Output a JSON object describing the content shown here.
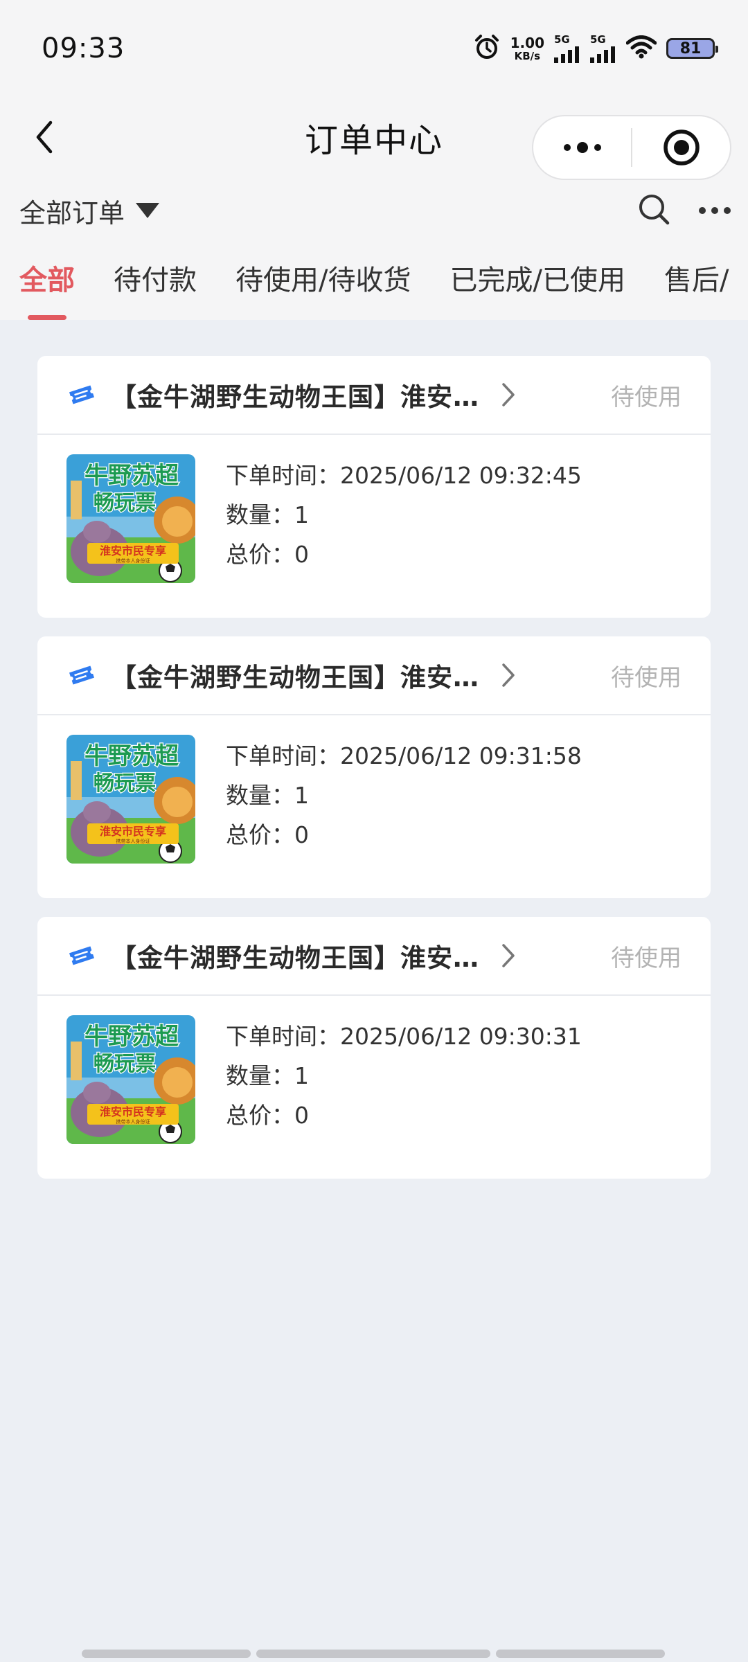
{
  "status_bar": {
    "time": "09:33",
    "net_speed_value": "1.00",
    "net_speed_unit": "KB/s",
    "sim1": "5G",
    "sim2": "5G",
    "battery": "81"
  },
  "nav": {
    "title": "订单中心",
    "back_icon": "chevron-left-icon",
    "more_icon": "more-dots-icon",
    "target_icon": "record-target-icon"
  },
  "filter": {
    "label": "全部订单",
    "dropdown_icon": "triangle-down-icon",
    "search_icon": "search-icon",
    "more_icon": "ellipsis-icon"
  },
  "tabs": [
    {
      "label": "全部",
      "active": true
    },
    {
      "label": "待付款",
      "active": false
    },
    {
      "label": "待使用/待收货",
      "active": false
    },
    {
      "label": "已完成/已使用",
      "active": false
    },
    {
      "label": "售后/",
      "active": false
    }
  ],
  "colors": {
    "accent": "#e2595f",
    "ticket_blue": "#2f7bf0",
    "status_gray": "#b3b3b3",
    "page_bg": "#eceff4"
  },
  "orders": [
    {
      "title": "【金牛湖野生动物王国】淮安市民专享",
      "status": "待使用",
      "time_label": "下单时间：",
      "time": "2025/06/12 09:32:45",
      "qty_label": "数量：",
      "qty": "1",
      "total_label": "总价：",
      "total": "0",
      "thumb_title_1": "牛野苏超",
      "thumb_title_2": "畅玩票",
      "thumb_banner": "淮安市民专享",
      "thumb_sub": "携带本人身份证"
    },
    {
      "title": "【金牛湖野生动物王国】淮安市民专享",
      "status": "待使用",
      "time_label": "下单时间：",
      "time": "2025/06/12 09:31:58",
      "qty_label": "数量：",
      "qty": "1",
      "total_label": "总价：",
      "total": "0",
      "thumb_title_1": "牛野苏超",
      "thumb_title_2": "畅玩票",
      "thumb_banner": "淮安市民专享",
      "thumb_sub": "携带本人身份证"
    },
    {
      "title": "【金牛湖野生动物王国】淮安市民专享",
      "status": "待使用",
      "time_label": "下单时间：",
      "time": "2025/06/12 09:30:31",
      "qty_label": "数量：",
      "qty": "1",
      "total_label": "总价：",
      "total": "0",
      "thumb_title_1": "牛野苏超",
      "thumb_title_2": "畅玩票",
      "thumb_banner": "淮安市民专享",
      "thumb_sub": "携带本人身份证"
    }
  ]
}
